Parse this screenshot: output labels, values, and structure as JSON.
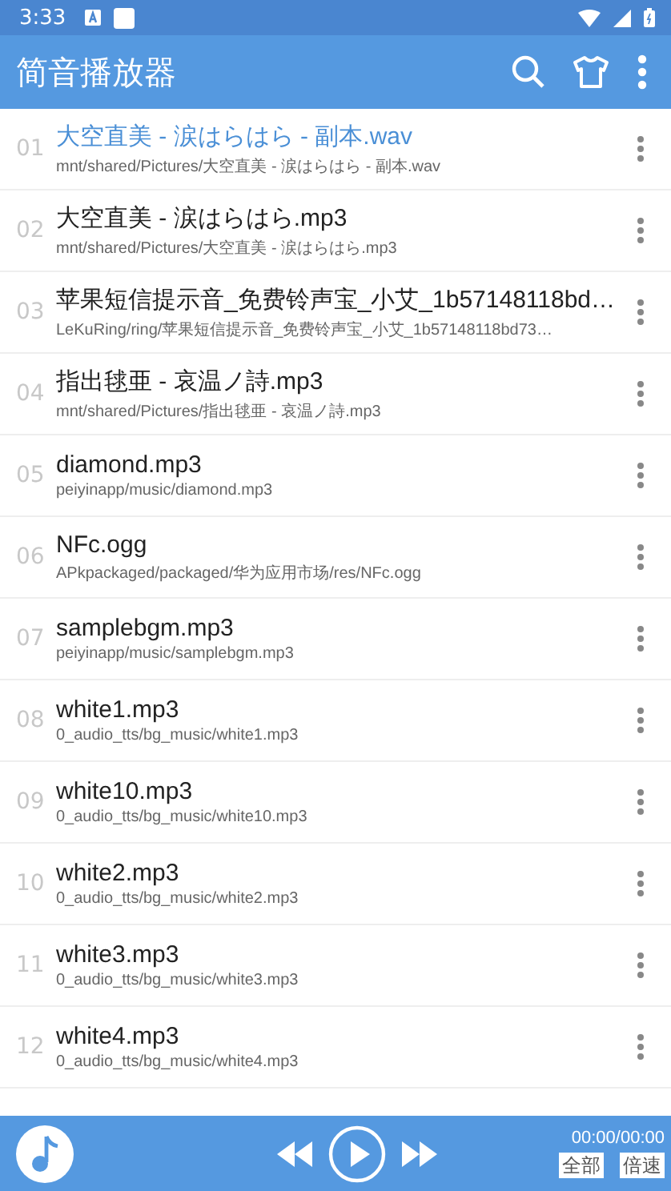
{
  "status_bar": {
    "time": "3:33"
  },
  "app_bar": {
    "title": "简音播放器"
  },
  "tracks": [
    {
      "index": "01",
      "title": "大空直美 - 涙はらはら - 副本.wav",
      "path": "mnt/shared/Pictures/大空直美 - 涙はらはら - 副本.wav",
      "selected": true
    },
    {
      "index": "02",
      "title": "大空直美 - 涙はらはら.mp3",
      "path": "mnt/shared/Pictures/大空直美 - 涙はらはら.mp3",
      "selected": false
    },
    {
      "index": "03",
      "title": "苹果短信提示音_免费铃声宝_小艾_1b57148118bd…",
      "path": "LeKuRing/ring/苹果短信提示音_免费铃声宝_小艾_1b57148118bd73…",
      "selected": false
    },
    {
      "index": "04",
      "title": "指出毬亜 - 哀温ノ詩.mp3",
      "path": "mnt/shared/Pictures/指出毬亜 - 哀温ノ詩.mp3",
      "selected": false
    },
    {
      "index": "05",
      "title": "diamond.mp3",
      "path": "peiyinapp/music/diamond.mp3",
      "selected": false
    },
    {
      "index": "06",
      "title": "NFc.ogg",
      "path": "APkpackaged/packaged/华为应用市场/res/NFc.ogg",
      "selected": false
    },
    {
      "index": "07",
      "title": "samplebgm.mp3",
      "path": "peiyinapp/music/samplebgm.mp3",
      "selected": false
    },
    {
      "index": "08",
      "title": "white1.mp3",
      "path": "0_audio_tts/bg_music/white1.mp3",
      "selected": false
    },
    {
      "index": "09",
      "title": "white10.mp3",
      "path": "0_audio_tts/bg_music/white10.mp3",
      "selected": false
    },
    {
      "index": "10",
      "title": "white2.mp3",
      "path": "0_audio_tts/bg_music/white2.mp3",
      "selected": false
    },
    {
      "index": "11",
      "title": "white3.mp3",
      "path": "0_audio_tts/bg_music/white3.mp3",
      "selected": false
    },
    {
      "index": "12",
      "title": "white4.mp3",
      "path": "0_audio_tts/bg_music/white4.mp3",
      "selected": false
    }
  ],
  "player": {
    "time": "00:00/00:00",
    "buttons": [
      "全部",
      "倍速"
    ]
  }
}
